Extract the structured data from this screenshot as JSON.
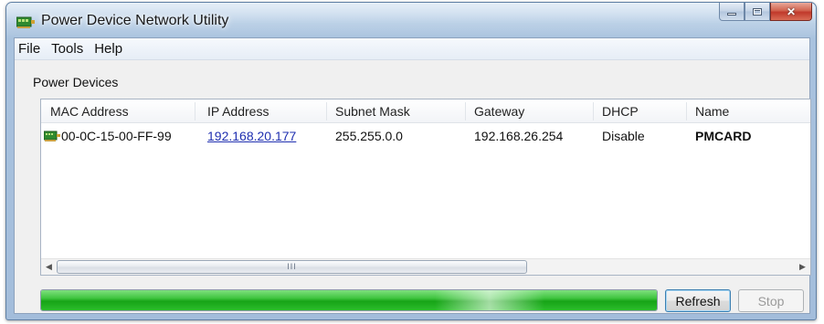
{
  "window": {
    "title": "Power Device Network Utility",
    "icon": "network-card-icon"
  },
  "menu": {
    "items": [
      "File",
      "Tools",
      "Help"
    ]
  },
  "group": {
    "label": "Power Devices"
  },
  "table": {
    "columns": [
      "MAC Address",
      "IP Address",
      "Subnet Mask",
      "Gateway",
      "DHCP",
      "Name"
    ],
    "rows": [
      {
        "icon": "network-card-icon",
        "mac": "00-0C-15-00-FF-99",
        "ip": "192.168.20.177",
        "subnet": "255.255.0.0",
        "gateway": "192.168.26.254",
        "dhcp": "Disable",
        "name": "PMCARD"
      }
    ]
  },
  "scrollbar": {
    "grip": "III"
  },
  "progress": {
    "value_percent": 100,
    "color": "#22b022"
  },
  "buttons": {
    "refresh": "Refresh",
    "stop": "Stop"
  },
  "colors": {
    "link": "#1f2fb0",
    "title_bar": "#b4cbe3",
    "close_button": "#c0392b"
  }
}
